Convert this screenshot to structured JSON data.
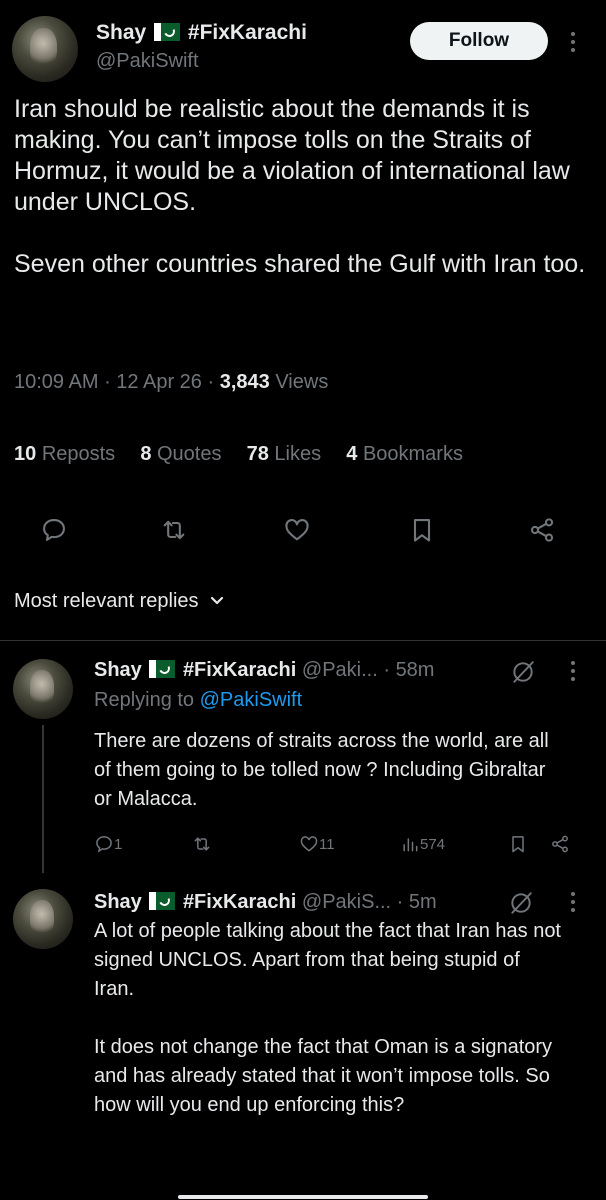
{
  "tweet": {
    "display_name": "Shay",
    "hashtag": "#FixKarachi",
    "handle": "@PakiSwift",
    "follow_label": "Follow",
    "body_p1": "Iran should be realistic about the demands it is making. You can’t impose tolls on the Straits of Hormuz, it would be a violation of international law under UNCLOS.",
    "body_p2": "Seven other countries shared the Gulf with Iran too.",
    "time": "10:09 AM",
    "date": "12 Apr 26",
    "views_count": "3,843",
    "views_label": "Views"
  },
  "stats": {
    "reposts_count": "10",
    "reposts_label": "Reposts",
    "quotes_count": "8",
    "quotes_label": "Quotes",
    "likes_count": "78",
    "likes_label": "Likes",
    "bookmarks_count": "4",
    "bookmarks_label": "Bookmarks"
  },
  "actions": [
    "reply-icon",
    "repost-icon",
    "like-icon",
    "bookmark-icon",
    "share-icon"
  ],
  "replies_filter": {
    "label": "Most relevant replies"
  },
  "replies": [
    {
      "display_name": "Shay",
      "hashtag": "#FixKarachi",
      "handle": "@Paki...",
      "time": "58m",
      "replying_prefix": "Replying to",
      "replying_handle": "@PakiSwift",
      "text": "There are dozens of straits across the world, are all of them going to be tolled now ? Including Gibraltar or Malacca.",
      "reply_count": "1",
      "like_count": "11",
      "view_count": "574"
    },
    {
      "display_name": "Shay",
      "hashtag": "#FixKarachi",
      "handle": "@PakiS...",
      "time": "5m",
      "text_p1": "A lot of people talking about the fact that Iran has not signed UNCLOS. Apart from that being stupid of Iran.",
      "text_p2": "It does not change the fact that Oman is a signatory and has already stated that it won’t impose tolls. So how will you end up enforcing this?"
    }
  ],
  "colors": {
    "background": "#000000",
    "text": "#e7e9ea",
    "secondary": "#71767b",
    "link": "#1d9bf0",
    "divider": "#2f3336",
    "flag_green": "#0a5c2c"
  }
}
